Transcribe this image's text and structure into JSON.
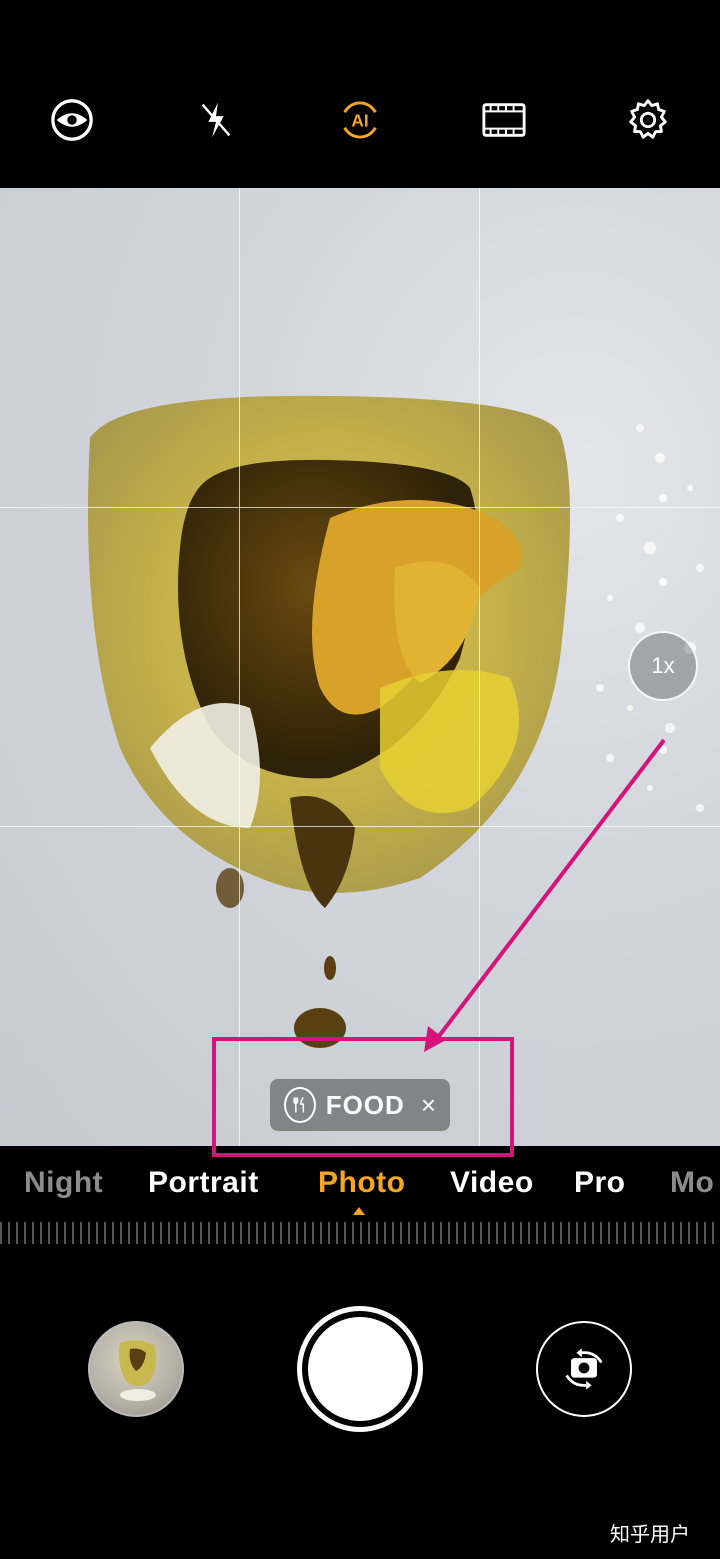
{
  "top_bar": {
    "icons": [
      "lens-mode-icon",
      "flash-off-icon",
      "ai-icon",
      "film-icon",
      "settings-icon"
    ],
    "ai_label": "AI",
    "ai_color": "#f5a623"
  },
  "viewfinder": {
    "zoom_label": "1x",
    "scene_chip": {
      "icon": "fork-knife-icon",
      "label": "FOOD",
      "close_glyph": "×"
    },
    "annotation_color": "#d4147a"
  },
  "modes": {
    "items": [
      "Night",
      "Portrait",
      "Photo",
      "Video",
      "Pro",
      "Mo"
    ],
    "active": "Photo",
    "active_color": "#f5a623"
  },
  "bottom": {
    "watermark": "知乎用户"
  }
}
